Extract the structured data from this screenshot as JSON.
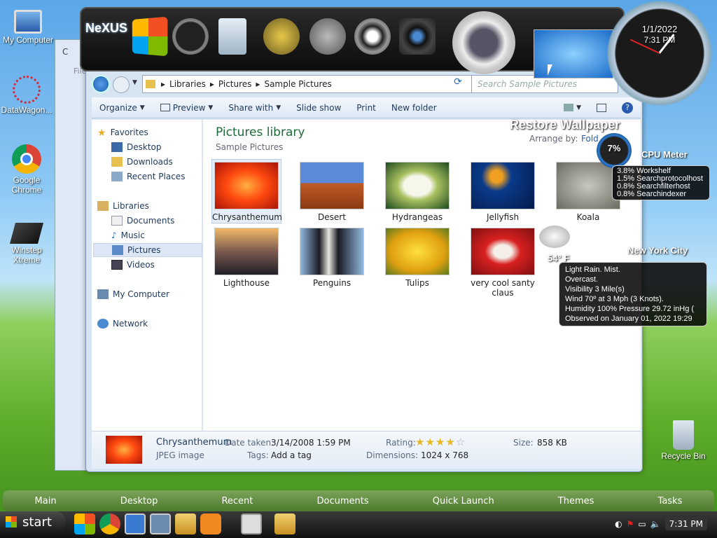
{
  "desktop": {
    "icons": [
      {
        "label": "My Computer"
      },
      {
        "label": "DataWagon..."
      },
      {
        "label": "Google Chrome"
      },
      {
        "label": "Winstep Xtreme"
      },
      {
        "label": "Recycle Bin"
      }
    ]
  },
  "dock": {
    "logo": "NeXUS",
    "preview_time": ""
  },
  "explorer": {
    "bg_window_title": "C",
    "bg_window_menu": "File",
    "breadcrumb": [
      "Libraries",
      "Pictures",
      "Sample Pictures"
    ],
    "search_placeholder": "Search Sample Pictures",
    "toolbar": {
      "organize": "Organize",
      "preview": "Preview",
      "share": "Share with",
      "slideshow": "Slide show",
      "print": "Print",
      "new_folder": "New folder"
    },
    "nav": {
      "favorites": "Favorites",
      "desktop": "Desktop",
      "downloads": "Downloads",
      "recent": "Recent Places",
      "libraries": "Libraries",
      "documents": "Documents",
      "music": "Music",
      "pictures": "Pictures",
      "videos": "Videos",
      "computer": "My Computer",
      "network": "Network"
    },
    "header": {
      "title": "Pictures library",
      "subtitle": "Sample Pictures",
      "arrange_label": "Arrange by:",
      "arrange_value": "Fold"
    },
    "pictures": [
      {
        "name": "Chrysanthemum",
        "c1": "#ff5a1a",
        "c2": "#b01808"
      },
      {
        "name": "Desert",
        "c1": "#5a8ad8",
        "c2": "#b0481c"
      },
      {
        "name": "Hydrangeas",
        "c1": "#f2f2e8",
        "c2": "#2a6a2a"
      },
      {
        "name": "Jellyfish",
        "c1": "#0a3a8a",
        "c2": "#e08a1a"
      },
      {
        "name": "Koala",
        "c1": "#b8b8b0",
        "c2": "#5a5a50"
      },
      {
        "name": "Lighthouse",
        "c1": "#2a2a38",
        "c2": "#d8a050"
      },
      {
        "name": "Penguins",
        "c1": "#88b0d8",
        "c2": "#1a1a22"
      },
      {
        "name": "Tulips",
        "c1": "#f0c020",
        "c2": "#c88a08"
      },
      {
        "name": "very cool santy claus",
        "c1": "#d82020",
        "c2": "#f4f0e8"
      }
    ],
    "details": {
      "name": "Chrysanthemum",
      "type": "JPEG image",
      "date_label": "Date taken:",
      "date": "3/14/2008 1:59 PM",
      "tags_label": "Tags:",
      "tags": "Add a tag",
      "rating_label": "Rating:",
      "rating": 4,
      "dim_label": "Dimensions:",
      "dim": "1024 x 768",
      "size_label": "Size:",
      "size": "858 KB"
    }
  },
  "gadgets": {
    "clock": {
      "date": "1/1/2022",
      "time": "7:31 PM"
    },
    "restore": "Restore Wallpaper",
    "cpu": {
      "title": "CPU Meter",
      "percent": "7%",
      "procs": [
        "3.8% Workshelf",
        "1.5% Searchprotocolhost",
        "0.8% Searchfilterhost",
        "0.8% Searchindexer"
      ]
    },
    "weather": {
      "city": "New York City",
      "temp": "54° F",
      "lines": [
        "Light Rain. Mist.",
        "Overcast.",
        "Visibility 3 Mile(s)",
        "Wind 70º at 3 Mph (3 Knots).",
        "Humidity 100%  Pressure 29.72 inHg (",
        "Observed on January 01, 2022 19:29"
      ]
    }
  },
  "menubar": [
    "Main",
    "Desktop",
    "Recent",
    "Documents",
    "Quick Launch",
    "Themes",
    "Tasks"
  ],
  "taskbar": {
    "start": "start",
    "time": "7:31 PM"
  },
  "colors": {
    "accent": "#1e6b3a",
    "link": "#1e3a5c"
  }
}
